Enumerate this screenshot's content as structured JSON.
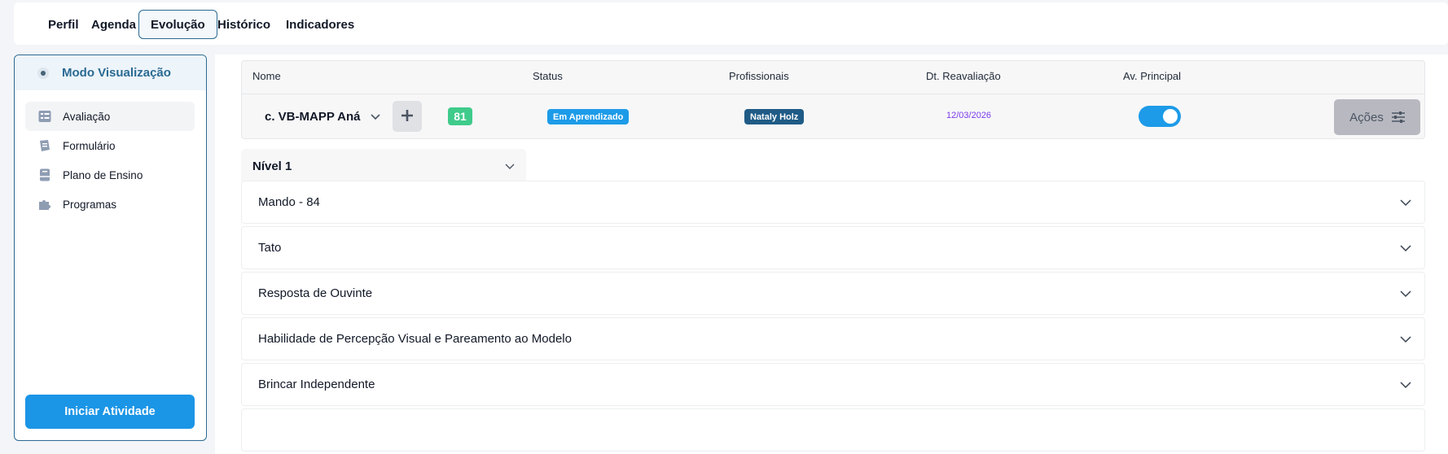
{
  "tabs": [
    {
      "label": "Perfil",
      "active": false
    },
    {
      "label": "Agenda",
      "active": false
    },
    {
      "label": "Evolução",
      "active": true
    },
    {
      "label": "Histórico",
      "active": false
    },
    {
      "label": "Indicadores",
      "active": false
    }
  ],
  "sidebar": {
    "mode_label": "Modo Visualização",
    "items": [
      {
        "label": "Avaliação",
        "icon": "checklist-icon",
        "selected": true
      },
      {
        "label": "Formulário",
        "icon": "form-icon",
        "selected": false
      },
      {
        "label": "Plano de Ensino",
        "icon": "teaching-plan-icon",
        "selected": false
      },
      {
        "label": "Programas",
        "icon": "puzzle-icon",
        "selected": false
      }
    ],
    "start_button": "Iniciar Atividade"
  },
  "table": {
    "headers": {
      "name": "Nome",
      "status": "Status",
      "professionals": "Profissionais",
      "reevaluation_date": "Dt. Reavaliação",
      "main_evaluation": "Av. Principal"
    },
    "row": {
      "name": "c. VB-MAPP Aná",
      "score": "81",
      "status": "Em Aprendizado",
      "professional": "Nataly Holz",
      "reevaluation_date": "12/03/2026",
      "main_evaluation_on": true,
      "actions_label": "Ações"
    }
  },
  "level_select": {
    "value": "Nível 1"
  },
  "sections": [
    "Mando - 84",
    "Tato",
    "Resposta de Ouvinte",
    "Habilidade de Percepção Visual e Pareamento ao Modelo",
    "Brincar Independente"
  ],
  "colors": {
    "accent": "#2a6a92",
    "primary_button": "#1b95e6",
    "status_badge": "#1d9be8",
    "professional_badge": "#1f5b86",
    "score_badge": "#3fcb8b",
    "date_text": "#7c3aed"
  }
}
